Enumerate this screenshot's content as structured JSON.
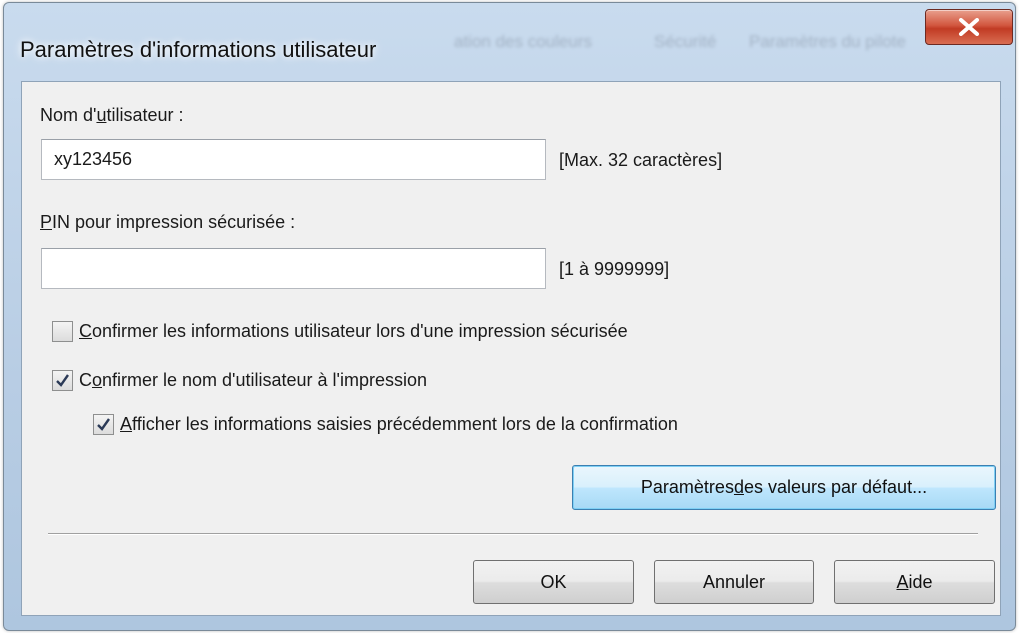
{
  "window": {
    "title": "Paramètres d'informations utilisateur",
    "close_icon": "close-icon",
    "title_color": "#111111",
    "close_color": "#c13b24"
  },
  "background_tabs": [
    "ation des couleurs",
    "Sécurité",
    "Paramètres du pilote"
  ],
  "username": {
    "label_pre": "Nom d'",
    "label_accel": "u",
    "label_post": "tilisateur :",
    "value": "xy123456",
    "hint": "[Max. 32 caractères]"
  },
  "pin": {
    "label_accel": "P",
    "label_post": "IN pour impression sécurisée :",
    "value": "",
    "hint": "[1 à 9999999]"
  },
  "options": {
    "confirm_secure": {
      "checked": false,
      "accel": "C",
      "rest": "onfirmer les informations utilisateur lors d'une impression sécurisée"
    },
    "confirm_name": {
      "checked": true,
      "pre": "C",
      "accel": "o",
      "rest": "nfirmer le nom d'utilisateur à l'impression"
    },
    "show_previous": {
      "checked": true,
      "accel": "A",
      "rest": "fficher les informations saisies précédemment lors de la confirmation"
    }
  },
  "defaults_button": {
    "pre": "Paramètres ",
    "accel": "d",
    "post": "es valeurs par défaut..."
  },
  "footer": {
    "ok_label": "OK",
    "cancel_label": "Annuler",
    "help_accel": "A",
    "help_rest": "ide"
  }
}
